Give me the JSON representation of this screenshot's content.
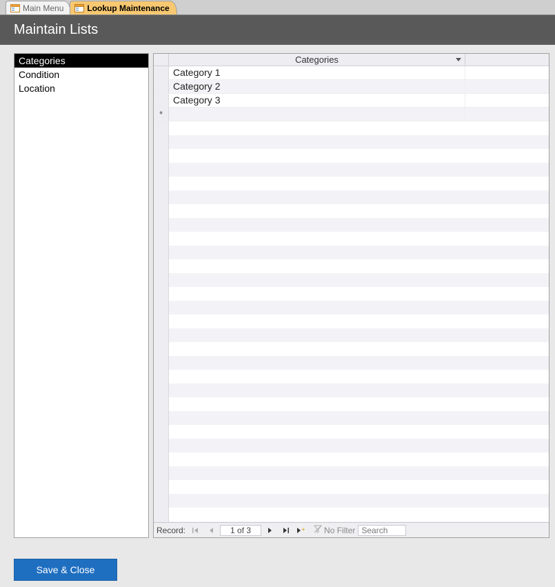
{
  "tabs": [
    {
      "label": "Main Menu",
      "active": false
    },
    {
      "label": "Lookup Maintenance",
      "active": true
    }
  ],
  "header": {
    "title": "Maintain Lists"
  },
  "sidebar": {
    "items": [
      {
        "label": "Categories",
        "selected": true
      },
      {
        "label": "Condition",
        "selected": false
      },
      {
        "label": "Location",
        "selected": false
      }
    ]
  },
  "grid": {
    "column_header": "Categories",
    "rows": [
      {
        "value": "Category 1"
      },
      {
        "value": "Category 2"
      },
      {
        "value": "Category 3"
      }
    ],
    "new_row_marker": "*"
  },
  "nav": {
    "label": "Record:",
    "position": "1 of 3",
    "filter_label": "No Filter",
    "search_placeholder": "Search"
  },
  "footer": {
    "save_close_label": "Save & Close"
  }
}
